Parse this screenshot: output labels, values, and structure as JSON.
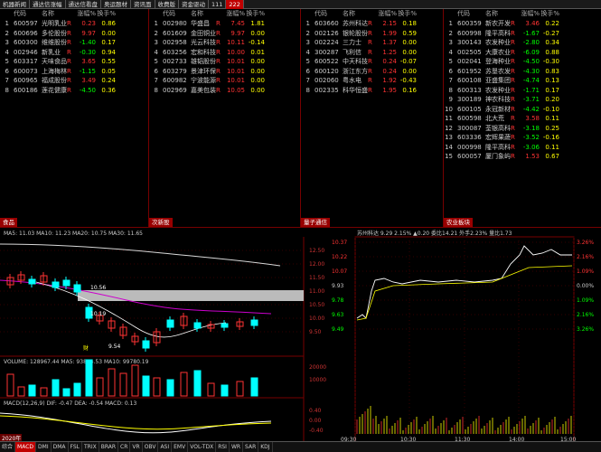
{
  "tabs": [
    "机器新闻",
    "通达信涨幅",
    "通达信看盘",
    "奥运题材",
    "资讯面",
    "收费版",
    "资金驱动",
    "111",
    "222"
  ],
  "panels": [
    {
      "title": "食品",
      "headers": [
        "代码",
        "名称",
        "涨幅%",
        "换手%"
      ],
      "rows": [
        {
          "i": "1",
          "code": "600597",
          "name": "光明乳业",
          "chg": "0.23",
          "vol": "0.86",
          "dir": "up"
        },
        {
          "i": "2",
          "code": "600696",
          "name": "多伦股份",
          "chg": "9.97",
          "vol": "0.00",
          "dir": "up"
        },
        {
          "i": "3",
          "code": "600300",
          "name": "维维股份",
          "chg": "-1.40",
          "vol": "0.17",
          "dir": "dn"
        },
        {
          "i": "4",
          "code": "002946",
          "name": "新乳业",
          "chg": "-0.30",
          "vol": "0.94",
          "dir": "dn"
        },
        {
          "i": "5",
          "code": "603317",
          "name": "天味食品",
          "chg": "3.65",
          "vol": "0.55",
          "dir": "up"
        },
        {
          "i": "6",
          "code": "600073",
          "name": "上海梅林",
          "chg": "-1.15",
          "vol": "0.05",
          "dir": "dn"
        },
        {
          "i": "7",
          "code": "600965",
          "name": "福成股份",
          "chg": "3.49",
          "vol": "0.24",
          "dir": "up"
        },
        {
          "i": "8",
          "code": "600186",
          "name": "莲花健康",
          "chg": "-4.50",
          "vol": "0.36",
          "dir": "dn"
        }
      ]
    },
    {
      "title": "次新股",
      "headers": [
        "代码",
        "名称",
        "涨幅%",
        "换手%"
      ],
      "rows": [
        {
          "i": "1",
          "code": "002980",
          "name": "华盛昌",
          "chg": "7.45",
          "vol": "1.81",
          "dir": "up"
        },
        {
          "i": "2",
          "code": "601609",
          "name": "金田铜业",
          "chg": "9.97",
          "vol": "0.00",
          "dir": "up"
        },
        {
          "i": "3",
          "code": "002958",
          "name": "光云科技",
          "chg": "10.11",
          "vol": "-0.14",
          "dir": "up"
        },
        {
          "i": "4",
          "code": "603256",
          "name": "宏和科技",
          "chg": "10.00",
          "vol": "0.01",
          "dir": "up"
        },
        {
          "i": "5",
          "code": "002733",
          "name": "雄韬股份",
          "chg": "10.01",
          "vol": "0.00",
          "dir": "up"
        },
        {
          "i": "6",
          "code": "603279",
          "name": "景津环保",
          "chg": "10.01",
          "vol": "0.00",
          "dir": "up"
        },
        {
          "i": "7",
          "code": "600982",
          "name": "宁波能源",
          "chg": "10.01",
          "vol": "0.00",
          "dir": "up"
        },
        {
          "i": "8",
          "code": "002969",
          "name": "嘉美包装",
          "chg": "10.05",
          "vol": "0.00",
          "dir": "up"
        }
      ]
    },
    {
      "title": "量子通信",
      "headers": [
        "代码",
        "名称",
        "涨幅%",
        "换手%"
      ],
      "rows": [
        {
          "i": "1",
          "code": "603660",
          "name": "苏州科达",
          "chg": "2.15",
          "vol": "0.18",
          "dir": "up"
        },
        {
          "i": "2",
          "code": "002126",
          "name": "银轮股份",
          "chg": "1.99",
          "vol": "0.59",
          "dir": "up"
        },
        {
          "i": "3",
          "code": "002224",
          "name": "三力士",
          "chg": "1.37",
          "vol": "0.00",
          "dir": "up"
        },
        {
          "i": "4",
          "code": "300287",
          "name": "飞利信",
          "chg": "1.25",
          "vol": "0.00",
          "dir": "up"
        },
        {
          "i": "5",
          "code": "600522",
          "name": "中天科技",
          "chg": "0.24",
          "vol": "-0.07",
          "dir": "up"
        },
        {
          "i": "6",
          "code": "600120",
          "name": "浙江东方",
          "chg": "0.24",
          "vol": "0.00",
          "dir": "up"
        },
        {
          "i": "7",
          "code": "002060",
          "name": "粤水电",
          "chg": "1.92",
          "vol": "-0.43",
          "dir": "up"
        },
        {
          "i": "8",
          "code": "002335",
          "name": "科华恒盛",
          "chg": "1.95",
          "vol": "0.16",
          "dir": "up"
        }
      ]
    },
    {
      "title": "农业板块",
      "headers": [
        "代码",
        "名称",
        "涨幅%",
        "换手%"
      ],
      "rows": [
        {
          "i": "1",
          "code": "600359",
          "name": "新农开发",
          "chg": "3.46",
          "vol": "0.22",
          "dir": "up"
        },
        {
          "i": "2",
          "code": "600998",
          "name": "隆平高科",
          "chg": "-1.67",
          "vol": "-0.27",
          "dir": "dn"
        },
        {
          "i": "3",
          "code": "300143",
          "name": "农发种业",
          "chg": "-2.80",
          "vol": "0.34",
          "dir": "dn"
        },
        {
          "i": "4",
          "code": "002505",
          "name": "大康农业",
          "chg": "-6.09",
          "vol": "0.88",
          "dir": "dn"
        },
        {
          "i": "5",
          "code": "002041",
          "name": "登海种业",
          "chg": "-4.50",
          "vol": "-0.30",
          "dir": "dn"
        },
        {
          "i": "6",
          "code": "601952",
          "name": "苏垦农发",
          "chg": "-4.30",
          "vol": "0.83",
          "dir": "dn"
        },
        {
          "i": "7",
          "code": "600108",
          "name": "亚盛集团",
          "chg": "-4.74",
          "vol": "0.13",
          "dir": "dn"
        },
        {
          "i": "8",
          "code": "600313",
          "name": "农发种业",
          "chg": "-1.71",
          "vol": "0.17",
          "dir": "dn"
        },
        {
          "i": "9",
          "code": "300189",
          "name": "神农科技",
          "chg": "-3.71",
          "vol": "0.20",
          "dir": "dn"
        },
        {
          "i": "10",
          "code": "600105",
          "name": "永冠新材",
          "chg": "-4.42",
          "vol": "-0.10",
          "dir": "dn"
        },
        {
          "i": "11",
          "code": "600598",
          "name": "北大荒",
          "chg": "3.58",
          "vol": "0.11",
          "dir": "up"
        },
        {
          "i": "12",
          "code": "300087",
          "name": "荃银高科",
          "chg": "-3.18",
          "vol": "0.25",
          "dir": "dn"
        },
        {
          "i": "13",
          "code": "603336",
          "name": "宏辉果蔬",
          "chg": "-3.52",
          "vol": "-0.16",
          "dir": "dn"
        },
        {
          "i": "14",
          "code": "000998",
          "name": "隆平高科",
          "chg": "-3.06",
          "vol": "0.11",
          "dir": "dn"
        },
        {
          "i": "15",
          "code": "600057",
          "name": "厦门象屿",
          "chg": "1.53",
          "vol": "0.67",
          "dir": "up"
        }
      ]
    }
  ],
  "kline": {
    "legend": "MA5: 11.03  MA10: 11.23  MA20: 10.75  MA30: 11.65",
    "yticks": [
      "12.50",
      "12.00",
      "11.50",
      "11.00",
      "10.50",
      "10.00",
      "9.50"
    ],
    "annotations": [
      "10.56",
      "10.19",
      "9.54"
    ],
    "vol_label": "VOLUME: 128967.44  MA5: 93864.53  MA10: 99780.19",
    "vol_ticks": [
      "20000",
      "10000"
    ],
    "macd_label": "MACD(12,26,9)  DIF: -0.47  DEA: -0.54  MACD: 0.13",
    "macd_ticks": [
      "0.40",
      "0.00",
      "-0.40"
    ],
    "date": "2020年"
  },
  "intraday": {
    "title": "苏州科达  9.29  2.15%  ▲0.20  委比14.21  外手2.23%  量比1.73",
    "yticks_left": [
      "10.37",
      "10.22",
      "10.07",
      "9.93",
      "9.78",
      "9.63",
      "9.49"
    ],
    "yticks_right": [
      "3.26%",
      "2.16%",
      "1.09%",
      "0.00%",
      "1.09%",
      "2.16%",
      "3.26%"
    ],
    "xticks": [
      "09:30",
      "10:30",
      "11:30",
      "14:00",
      "15:00"
    ]
  },
  "bottom_tabs": [
    "综合",
    "MACD",
    "DMI",
    "DMA",
    "FSL",
    "TRIX",
    "BRAR",
    "CR",
    "VR",
    "OBV",
    "ASI",
    "EMV",
    "VOL-TDX",
    "RSI",
    "WR",
    "SAR",
    "KDJ"
  ]
}
